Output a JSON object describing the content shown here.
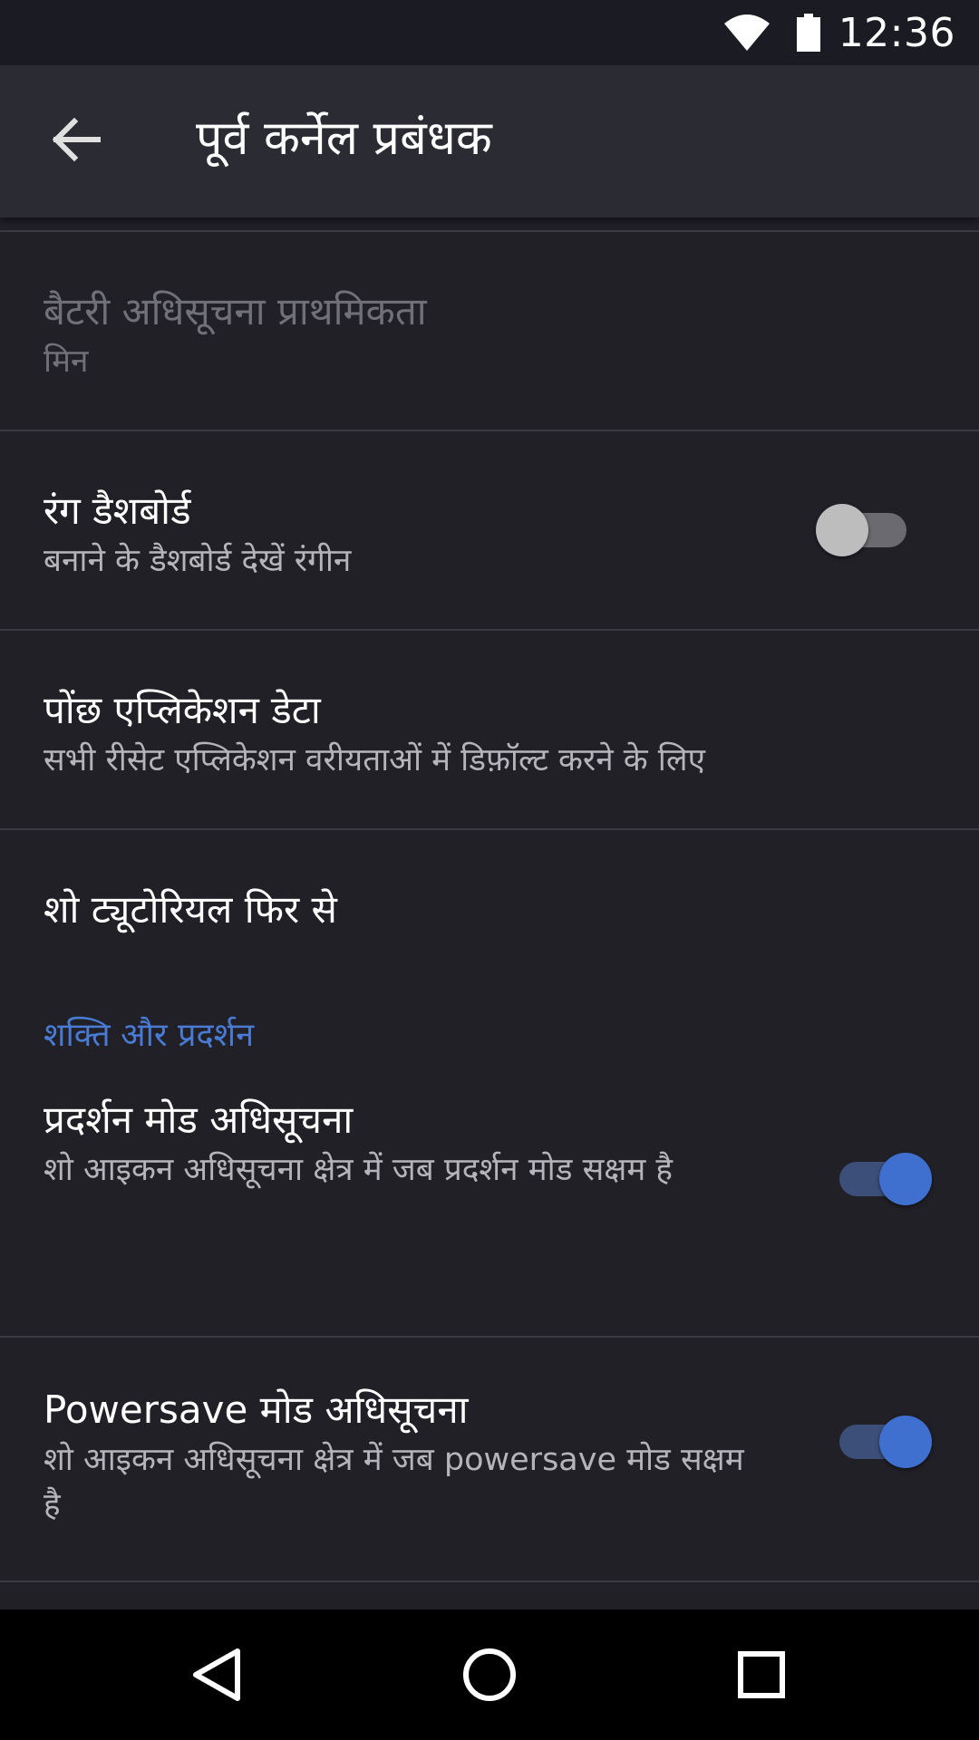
{
  "status_bar": {
    "time": "12:36",
    "icons": [
      "wifi-icon",
      "battery-icon"
    ]
  },
  "app_bar": {
    "back_icon": "arrow-left-icon",
    "title": "पूर्व कर्नेल प्रबंधक"
  },
  "settings": {
    "battery_priority": {
      "title": "बैटरी अधिसूचना प्राथमिकता",
      "summary": "मिन",
      "enabled": false
    },
    "color_dashboard": {
      "title": "रंग डैशबोर्ड",
      "summary": "बनाने के डैशबोर्ड देखें रंगीन",
      "switch_on": false
    },
    "clear_app_data": {
      "title": "पोंछ एप्लिकेशन डेटा",
      "summary": "सभी रीसेट एप्लिकेशन वरीयताओं में डिफ़ॉल्ट करने के लिए"
    },
    "show_tutorial": {
      "title": "शो ट्यूटोरियल फिर से"
    },
    "category_power": {
      "label": "शक्ति और प्रदर्शन",
      "color": "#4a7bd4"
    },
    "performance_notification": {
      "title": "प्रदर्शन मोड अधिसूचना",
      "summary": "शो आइकन अधिसूचना क्षेत्र में जब प्रदर्शन मोड सक्षम है",
      "switch_on": true
    },
    "powersave_notification": {
      "title": "Powersave मोड अधिसूचना",
      "summary": "शो आइकन अधिसूचना क्षेत्र में जब powersave मोड सक्षम है",
      "switch_on": true
    }
  },
  "nav_bar": {
    "icons": [
      "back-triangle-icon",
      "home-circle-icon",
      "recents-square-icon"
    ]
  },
  "colors": {
    "background": "#212027",
    "app_bar": "#2b2b34",
    "accent": "#3f6fcf"
  }
}
